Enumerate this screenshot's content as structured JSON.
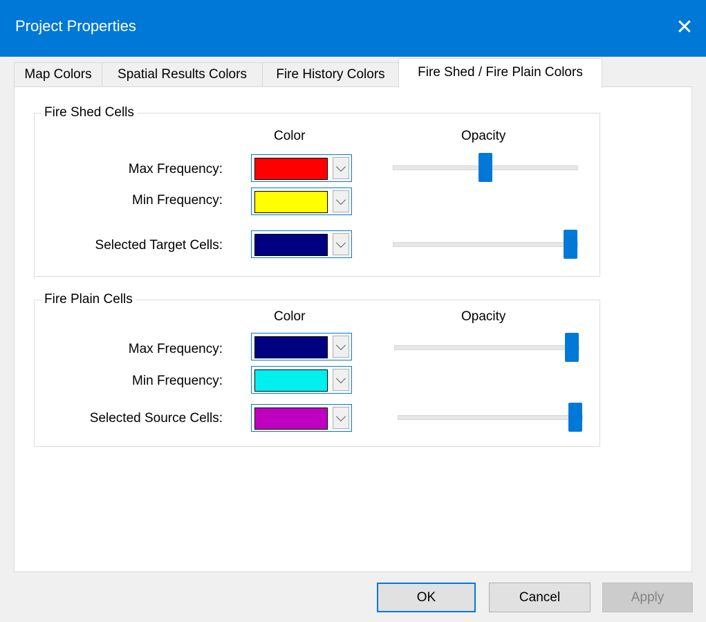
{
  "window": {
    "title": "Project Properties",
    "close_glyph": "✕"
  },
  "tabs": [
    {
      "label": "Map Colors",
      "active": false
    },
    {
      "label": "Spatial Results Colors",
      "active": false
    },
    {
      "label": "Fire History Colors",
      "active": false
    },
    {
      "label": "Fire Shed / Fire Plain Colors",
      "active": true
    }
  ],
  "fire_shed": {
    "legend": "Fire Shed Cells",
    "color_header": "Color",
    "opacity_header": "Opacity",
    "rows": [
      {
        "label": "Max Frequency:",
        "color": "#ff0000",
        "opacity": 0.5
      },
      {
        "label": "Min Frequency:",
        "color": "#ffff00"
      },
      {
        "label": "Selected Target Cells:",
        "color": "#000080",
        "opacity": 1.0
      }
    ]
  },
  "fire_plain": {
    "legend": "Fire Plain Cells",
    "color_header": "Color",
    "opacity_header": "Opacity",
    "rows": [
      {
        "label": "Max Frequency:",
        "color": "#000080",
        "opacity": 1.0
      },
      {
        "label": "Min Frequency:",
        "color": "#00f0f0"
      },
      {
        "label": "Selected Source Cells:",
        "color": "#c000c0",
        "opacity": 1.0
      }
    ]
  },
  "buttons": {
    "ok": "OK",
    "cancel": "Cancel",
    "apply": "Apply"
  },
  "colors": {
    "accent": "#0078d7"
  }
}
